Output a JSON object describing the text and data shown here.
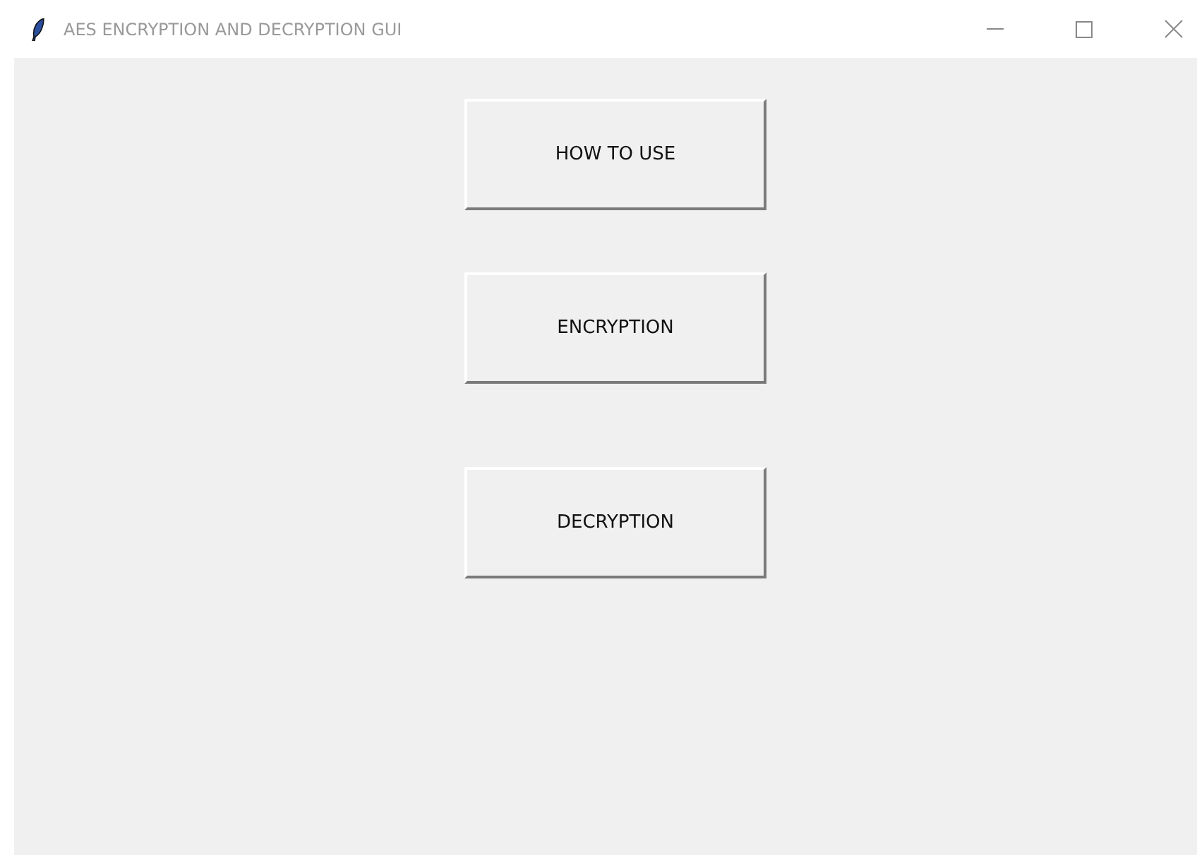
{
  "window": {
    "title": "AES ENCRYPTION AND DECRYPTION GUI"
  },
  "buttons": [
    {
      "label": "HOW TO USE"
    },
    {
      "label": "ENCRYPTION"
    },
    {
      "label": "DECRYPTION"
    }
  ]
}
